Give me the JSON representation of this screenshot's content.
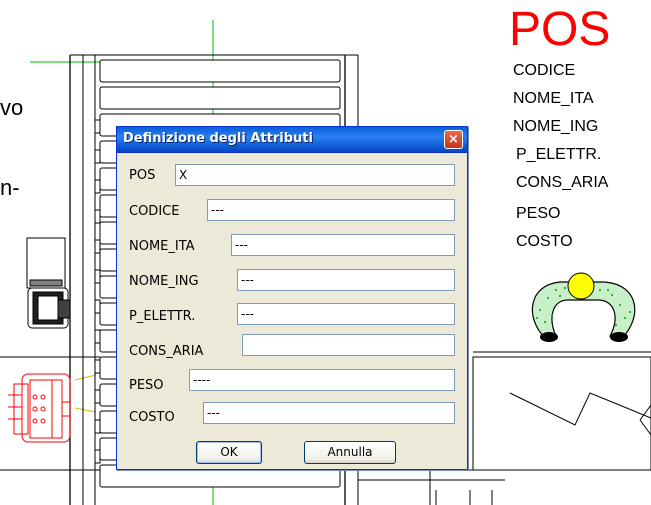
{
  "drawing": {
    "pos_title": "POS",
    "attribute_list": [
      "CODICE",
      "NOME_ITA",
      "NOME_ING",
      "P_ELETTR.",
      "CONS_ARIA",
      "PESO",
      "COSTO"
    ],
    "partial_text_1": "vo",
    "partial_text_2": "n-"
  },
  "dialog": {
    "title": "Definizione degli Attributi",
    "close_label": "×",
    "fields": [
      {
        "label": "POS",
        "value": "X"
      },
      {
        "label": "CODICE",
        "value": "---"
      },
      {
        "label": "NOME_ITA",
        "value": "---"
      },
      {
        "label": "NOME_ING",
        "value": "---"
      },
      {
        "label": "P_ELETTR.",
        "value": "---"
      },
      {
        "label": "CONS_ARIA",
        "value": ""
      },
      {
        "label": "PESO",
        "value": "----"
      },
      {
        "label": "COSTO",
        "value": "---"
      }
    ],
    "ok_label": "OK",
    "cancel_label": "Annulla"
  },
  "colors": {
    "pos_title": "#ff0000",
    "titlebar": "#0a5ed8",
    "dialog_bg": "#ece9d8",
    "cad_red": "#ff0000",
    "cad_green": "#00c000",
    "person_head": "#ffff00"
  }
}
